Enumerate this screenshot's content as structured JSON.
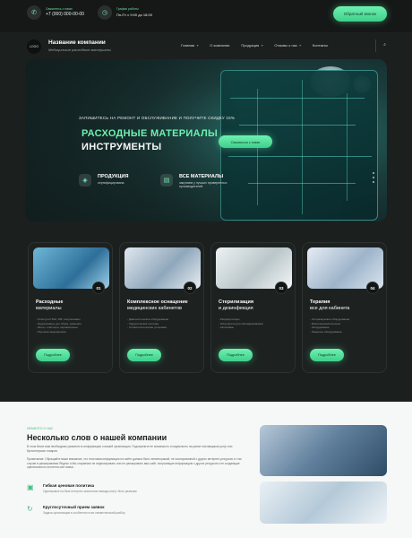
{
  "topbar": {
    "phone_caption": "Свяжитесь с нами",
    "phone": "+7 (000) 000-00-00",
    "hours_caption": "График работы",
    "hours": "Пн-Пт с 9:00 до 18:00",
    "callback_label": "Обратный звонок"
  },
  "brand": {
    "logo_text": "LOGO",
    "name": "Название компании",
    "subtitle": "Медицинские расходные материалы"
  },
  "nav": {
    "items": [
      "Главная",
      "О компании",
      "Продукция",
      "Отзывы о нас",
      "Контакты"
    ]
  },
  "hero": {
    "promo": "ЗАПИШИТЕСЬ НА РЕМОНТ И ОБСЛУЖИВАНИЕ И ПОЛУЧИТЕ СКИДКУ 15%",
    "title_line1": "РАСХОДНЫЕ МАТЕРИАЛЫ",
    "title_line2": "ИНСТРУМЕНТЫ",
    "button_label": "Связаться с нами",
    "feature1_title": "ПРОДУКЦИЯ",
    "feature1_sub": "сертифицирована",
    "feature2_title": "ВСЕ МАТЕРИАЛЫ",
    "feature2_sub": "закупаем у лучших проверенных производителей"
  },
  "cards": [
    {
      "num": "01",
      "title1": "Расходные",
      "title2": "материалы",
      "list": [
        "- Голки для ПЭН, ЭКГ, инсулиновых",
        "- Одноразовые для сбора, хранения",
        "- бинты, пластыри, перевязочные",
        "- Перчатки медицинские"
      ],
      "button": "Подробнее"
    },
    {
      "num": "02",
      "title1": "Комплексное оснащение",
      "title2": "медицинских кабинетов",
      "list": [
        "- Диагностическое оборудование",
        "- Хирургические системы",
        "- Стоматологические установки"
      ],
      "button": "Подробнее"
    },
    {
      "num": "03",
      "title1": "Стерилизация",
      "title2": "и дезинфекция",
      "list": [
        "- Рециркуляторы",
        "- Облучатели для обеззараживания",
        "- Автоклавы"
      ],
      "button": "Подробнее"
    },
    {
      "num": "04",
      "title1": "Терапия",
      "title2": "все для кабинета",
      "list": [
        "- Ультразвуковое оборудование",
        "- Физиотерапевтическое",
        "- оборудование",
        "- Лазерное оборудование"
      ],
      "button": "Подробнее"
    }
  ],
  "about": {
    "kicker": "НЕМНОГО О НАС",
    "title": "Несколько слов о нашей компании",
    "p1": "В этом блоке вам необходимо разместить информацию о вашей организации. Подчеркните ее значимость и надежность на рынке поставщиков услуг или бухгалтерских товаров.",
    "p2": "Примечание: Обращайте ваше внимание, что текстовая информация на сайте должна быть неповторимой, не скопированной с других интернет-ресурсов, в том случае в ранжировании Яндекс и Мы стараемся не индексировать или не ранжировать ваш сайт, получающие информацию с других ресурсов и не создающие оригинального контента или новых.",
    "b1_title": "Гибкая ценовая политика",
    "b1_sub": "Одинаковые на базе интернет-аналитики выводы могут быть разными",
    "b2_title": "Круглосуточный прием заявок",
    "b2_sub": "Задача организации в особенности же семантический разбор"
  }
}
